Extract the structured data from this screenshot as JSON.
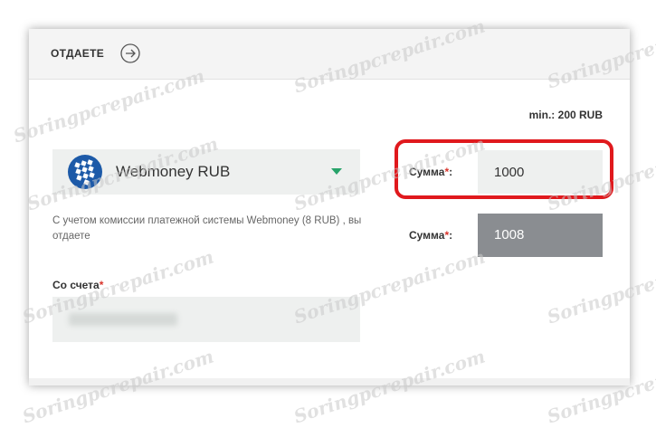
{
  "header": {
    "title": "ОТДАЕТЕ"
  },
  "limits": {
    "min_text": "min.: 200 RUB"
  },
  "payment_method": {
    "selected": "Webmoney RUB"
  },
  "commission_note": "С учетом комиссии платежной системы Webmoney (8 RUB) , вы отдаете",
  "account": {
    "label": "Со счета",
    "required_mark": "*"
  },
  "amount": {
    "label": "Сумма",
    "required_mark": "*",
    "value": "1000"
  },
  "total": {
    "label": "Сумма",
    "required_mark": "*",
    "value": "1008"
  },
  "watermark": "Soringpcrepair.com",
  "colors": {
    "highlight": "#e0191d",
    "accent": "#27a36a",
    "output_bg": "#8a8d91"
  }
}
